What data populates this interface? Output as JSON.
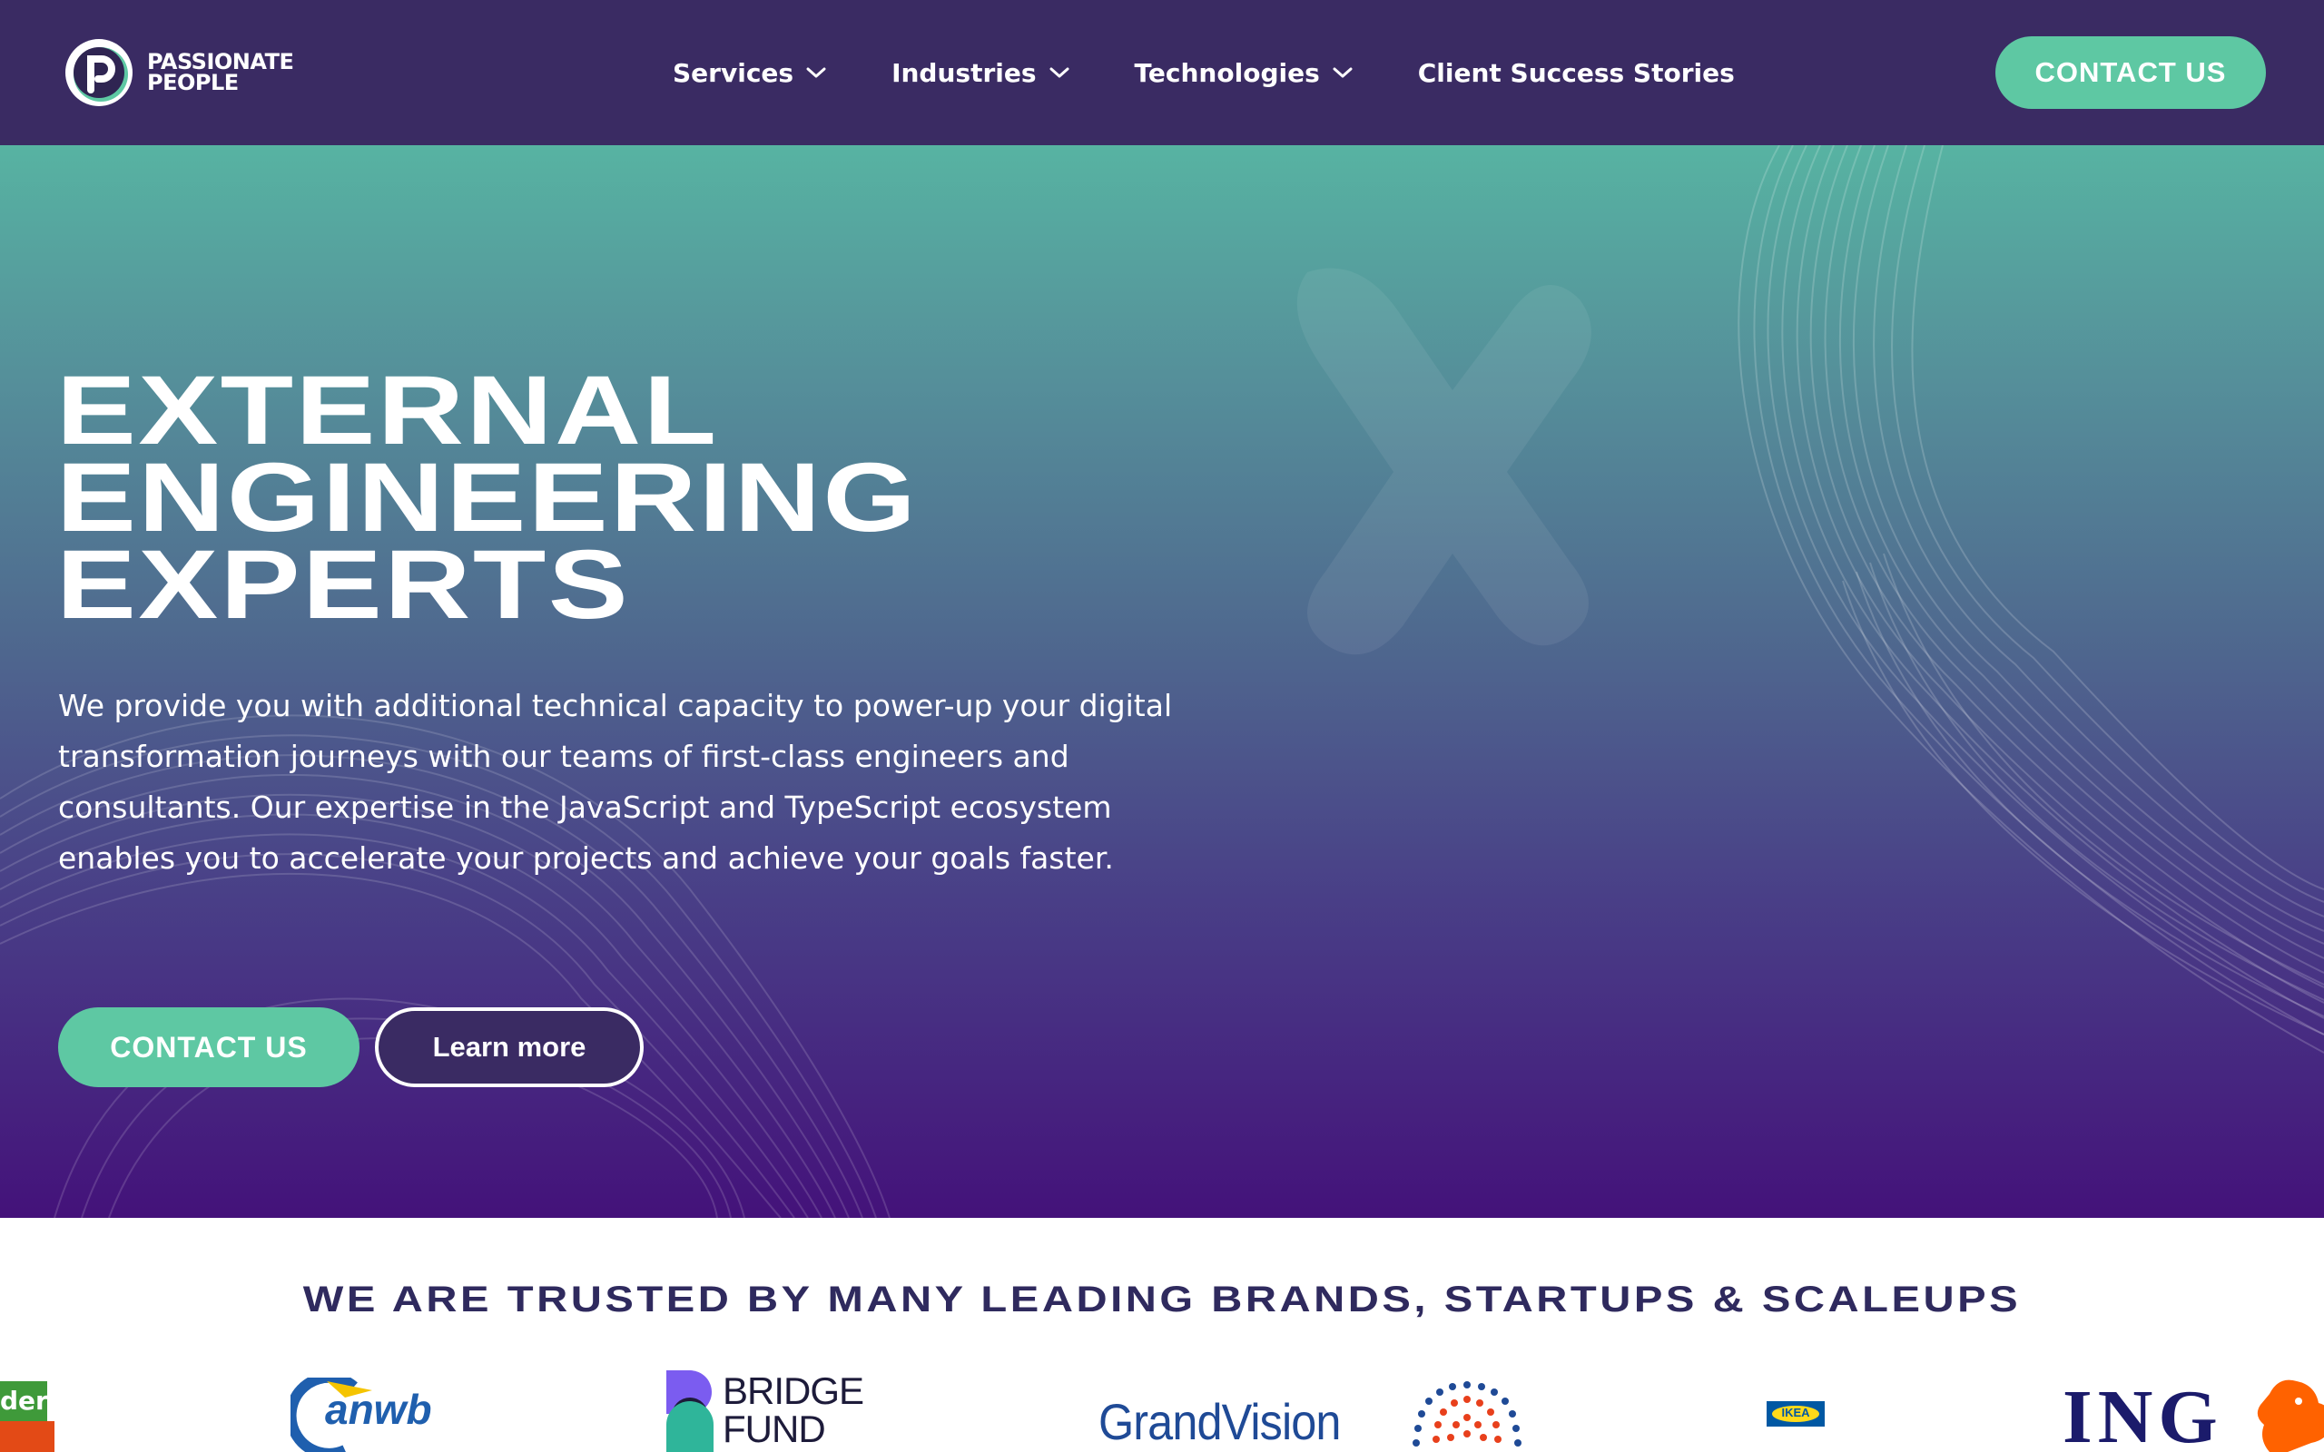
{
  "brand": {
    "line1": "PASSIONATE",
    "line2": "PEOPLE"
  },
  "nav": {
    "items": [
      {
        "label": "Services",
        "has_dropdown": true
      },
      {
        "label": "Industries",
        "has_dropdown": true
      },
      {
        "label": "Technologies",
        "has_dropdown": true
      },
      {
        "label": "Client Success Stories",
        "has_dropdown": false
      }
    ],
    "cta_label": "CONTACT US"
  },
  "hero": {
    "title_lines": [
      "EXTERNAL",
      "ENGINEERING",
      "EXPERTS"
    ],
    "description": "We provide you with additional technical capacity to power-up your digital transformation journeys with our teams of first-class engineers and consultants. Our expertise in the JavaScript and TypeScript ecosystem enables you to accelerate your projects and achieve your goals faster.",
    "primary_button": "CONTACT US",
    "secondary_button": "Learn more"
  },
  "trusted": {
    "title": "WE ARE TRUSTED BY MANY LEADING BRANDS, STARTUPS & SCALEUPS",
    "logos": {
      "partial_left": "der",
      "anwb": "anwb",
      "bridgefund_line1": "BRIDGE",
      "bridgefund_line2": "FUND",
      "grandvision": "GrandVision",
      "ikea": "IKEA",
      "ing": "ING"
    }
  },
  "colors": {
    "nav_bg": "#3a2b63",
    "accent": "#5ec8a3",
    "hero_top": "#57b3a2",
    "hero_bottom": "#44127a",
    "heading_dark": "#2f2a5e"
  }
}
